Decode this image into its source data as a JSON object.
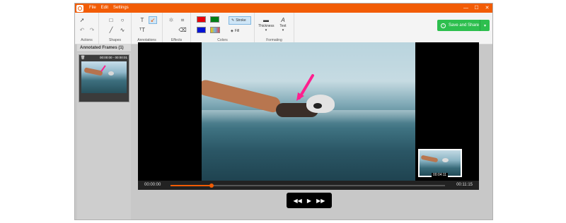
{
  "menu": {
    "items": [
      "File",
      "Edit",
      "Settings"
    ]
  },
  "window_controls": {
    "minimize": "—",
    "maximize": "☐",
    "close": "✕"
  },
  "ribbon": {
    "groups": {
      "actions": "Actions",
      "shapes": "Shapes",
      "annotations": "Annotations",
      "effects": "Effects",
      "colors": "Colors",
      "formatting": "Formating"
    },
    "stroke_label": "Stroke",
    "fill_label": "Fill",
    "thickness_label": "Thickness",
    "text_label": "Text",
    "swatches": [
      "#e8000b",
      "#007f15",
      "#0012d6"
    ]
  },
  "save_button": {
    "label": "Save and Share",
    "icon": "upload-cloud-icon",
    "color": "#2dbf4e"
  },
  "frames_panel": {
    "title": "Annotated Frames (1)",
    "frames": [
      {
        "time": "00:00:00 - 00:00:01"
      }
    ]
  },
  "player": {
    "current_time": "00:00:00",
    "end_time": "00:11:15",
    "mini_preview_time": "00:04:11",
    "progress": 0.15,
    "accent": "#f25c05",
    "arrow_color": "#ff1f8e"
  },
  "controls": {
    "rewind": "◀◀",
    "play": "▶",
    "forward": "▶▶"
  }
}
